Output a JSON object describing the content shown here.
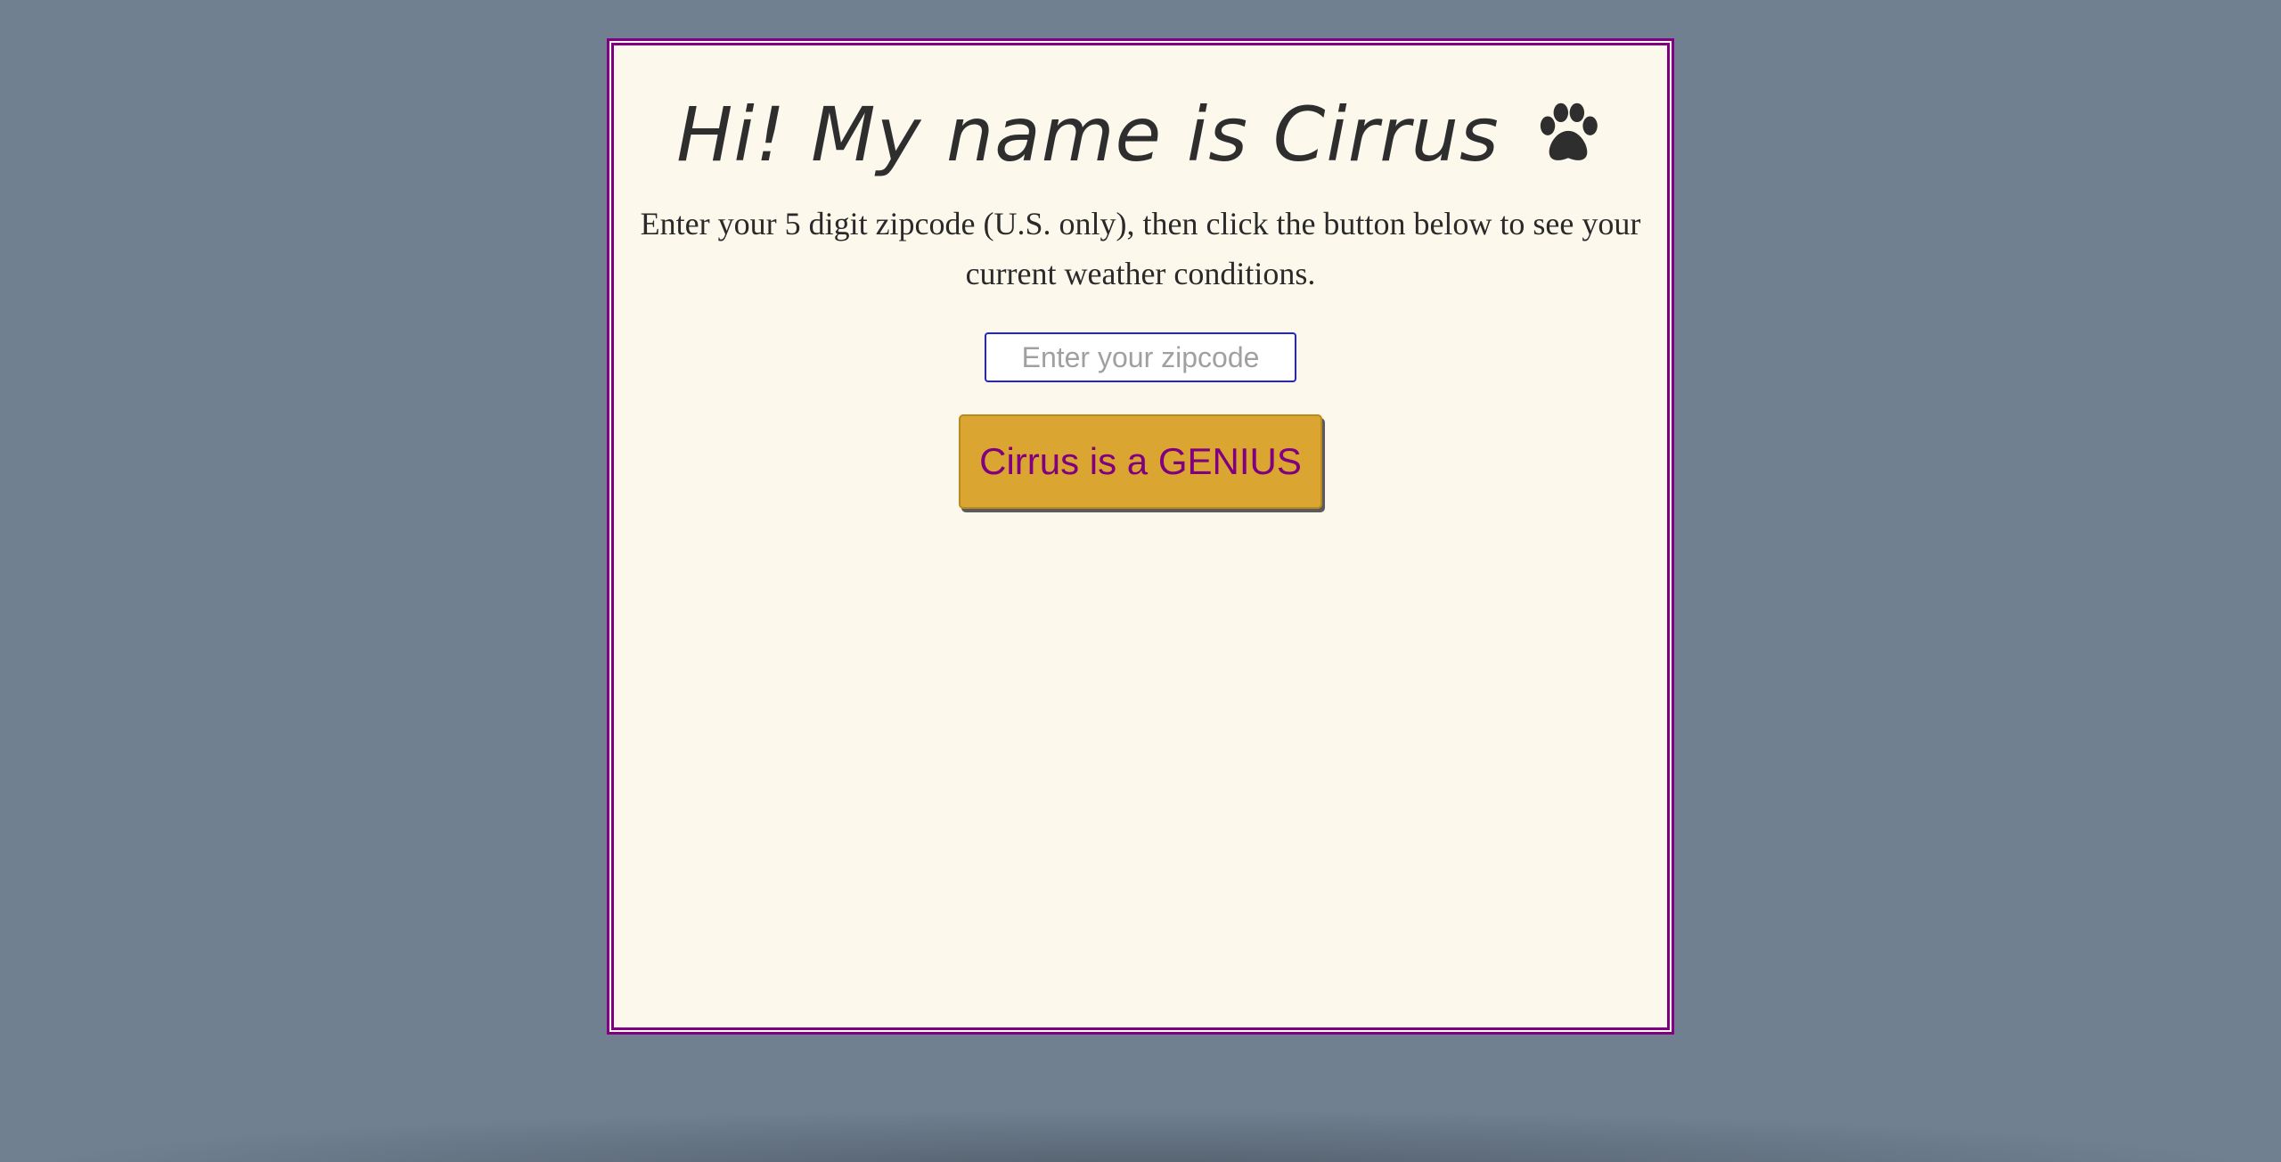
{
  "page": {
    "background_color": "#708090",
    "card_background": "#fdf8ec",
    "card_border_color": "#800080"
  },
  "header": {
    "title": "Hi! My name is Cirrus",
    "title_icon": "paw-icon"
  },
  "instructions": {
    "text": "Enter your 5 digit zipcode (U.S. only), then click the button below to see your current weather conditions."
  },
  "zip_input": {
    "value": "",
    "placeholder": "Enter your zipcode",
    "border_color": "#2323d8"
  },
  "submit_button": {
    "label": "Cirrus is a GENIUS",
    "background_color": "#daa530",
    "text_color": "#800080"
  }
}
